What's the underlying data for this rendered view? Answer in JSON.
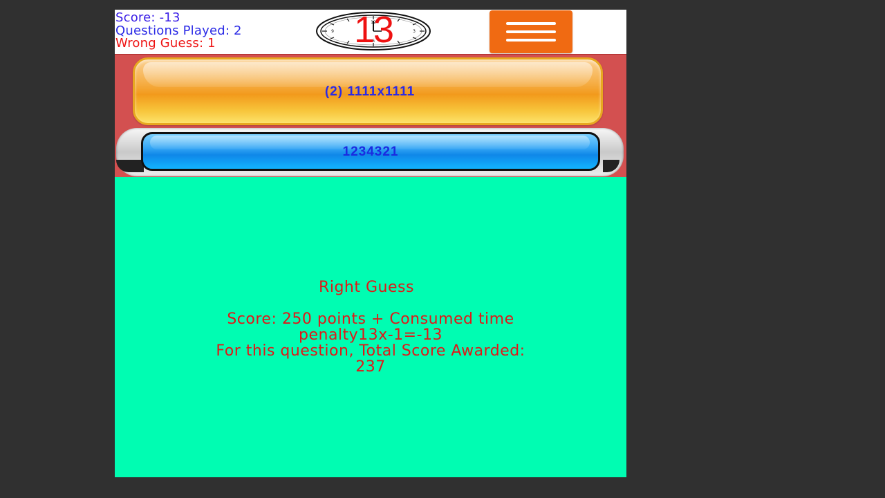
{
  "stats": {
    "score": "Score: -13",
    "questions_played": "Questions Played: 2",
    "wrong_guess": "Wrong Guess: 1"
  },
  "timer": {
    "value": "13",
    "icon": "clock-icon",
    "color": "#ee1111"
  },
  "menu": {
    "icon": "hamburger-menu-icon",
    "color": "#f06a12"
  },
  "question": {
    "text": "(2) 1111x1111"
  },
  "answer": {
    "text": "1234321"
  },
  "result": {
    "title": "Right Guess",
    "lines": [
      "Score: 250 points + Consumed time",
      "penalty13x-1=-13",
      "For this question, Total Score Awarded:",
      "237"
    ],
    "color": "#e01818",
    "background": "#00fdb2"
  }
}
